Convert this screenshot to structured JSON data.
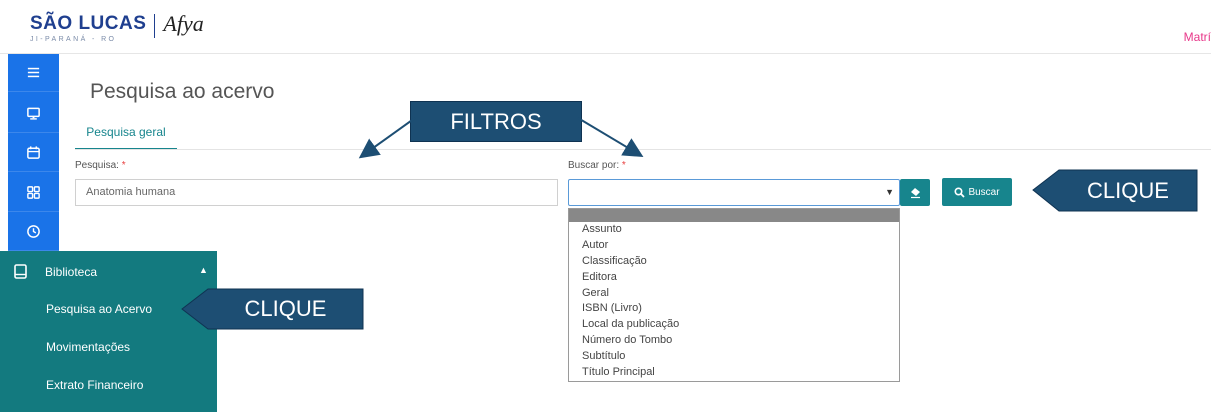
{
  "header": {
    "logo_main": "SÃO LUCAS",
    "logo_sub": "JI-PARANÁ - RO",
    "logo_afya": "Afya",
    "top_right_text": "Matrí"
  },
  "sidebar": {
    "icons": [
      "menu-icon",
      "monitor-icon",
      "calendar-icon",
      "grid-icon",
      "clock-icon"
    ],
    "menu_section": "Biblioteca",
    "items": [
      "Pesquisa ao Acervo",
      "Movimentações",
      "Extrato Financeiro"
    ]
  },
  "main": {
    "title": "Pesquisa ao acervo",
    "tab_label": "Pesquisa geral",
    "search_label": "Pesquisa:",
    "search_value": "Anatomia humana",
    "buscar_por_label": "Buscar por:",
    "required_mark": "*",
    "search_button": "Buscar",
    "dropdown_options": [
      "Assunto",
      "Autor",
      "Classificação",
      "Editora",
      "Geral",
      "ISBN (Livro)",
      "Local da publicação",
      "Número do Tombo",
      "Subtítulo",
      "Título Principal"
    ]
  },
  "annotations": {
    "filtros": "FILTROS",
    "clique_1": "CLIQUE",
    "clique_2": "CLIQUE"
  },
  "colors": {
    "teal": "#17858d",
    "sidebar_teal": "#137a7f",
    "sidebar_blue": "#1a73e8",
    "callout": "#1d4e73",
    "accent_pink": "#e8388a"
  }
}
